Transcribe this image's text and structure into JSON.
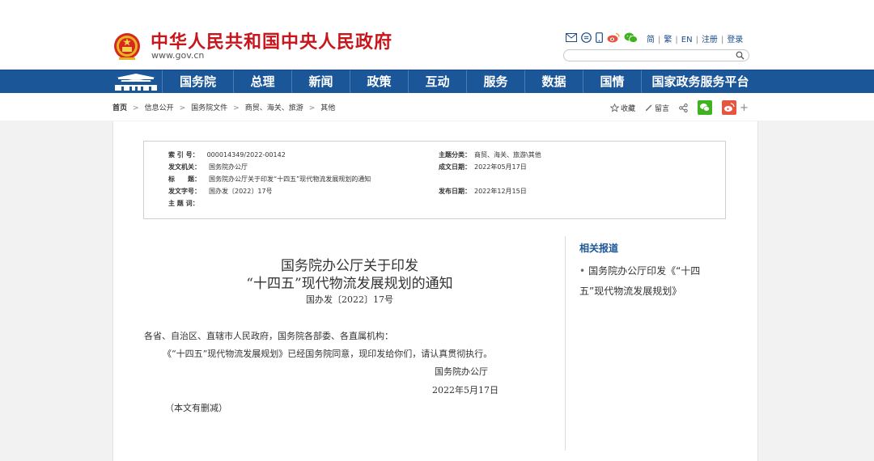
{
  "header": {
    "site_title": "中华人民共和国中央人民政府",
    "site_url": "www.gov.cn",
    "top_links": [
      "简",
      "繁",
      "EN",
      "注册",
      "登录"
    ]
  },
  "nav": {
    "items": [
      "国务院",
      "总理",
      "新闻",
      "政策",
      "互动",
      "服务",
      "数据",
      "国情",
      "国家政务服务平台"
    ]
  },
  "breadcrumb": {
    "items": [
      "首页",
      "信息公开",
      "国务院文件",
      "商贸、海关、旅游",
      "其他"
    ]
  },
  "tools": {
    "collect": "收藏",
    "comment": "留言",
    "plus": "+"
  },
  "meta": {
    "index_no_label": "索 引 号：",
    "index_no": "000014349/2022-00142",
    "subject_category_label": "主题分类：",
    "subject_category": "商贸、海关、旅游\\其他",
    "issuer_label": "发文机关：",
    "issuer": "国务院办公厅",
    "date_written_label": "成文日期：",
    "date_written": "2022年05月17日",
    "title_label": "标　　题：",
    "title": "国务院办公厅关于印发“十四五”现代物流发展规划的通知",
    "doc_no_label": "发文字号：",
    "doc_no": "国办发〔2022〕17号",
    "publish_date_label": "发布日期：",
    "publish_date": "2022年12月15日",
    "keywords_label": "主 题 词："
  },
  "article": {
    "title_line1": "国务院办公厅关于印发",
    "title_line2": "“十四五”现代物流发展规划的通知",
    "doc_no": "国办发〔2022〕17号",
    "salutation": "各省、自治区、直辖市人民政府，国务院各部委、各直属机构：",
    "body": "《“十四五”现代物流发展规划》已经国务院同意，现印发给你们，请认真贯彻执行。",
    "signature": "国务院办公厅",
    "date": "2022年5月17日",
    "note": "（本文有删减）"
  },
  "related": {
    "title": "相关报道",
    "items": [
      "国务院办公厅印发《“十四五”现代物流发展规划》"
    ]
  },
  "colors": {
    "brand_red": "#c8161d",
    "nav_blue": "#1b5698",
    "wechat_green": "#3fb21f",
    "weibo_red": "#e6553f"
  }
}
